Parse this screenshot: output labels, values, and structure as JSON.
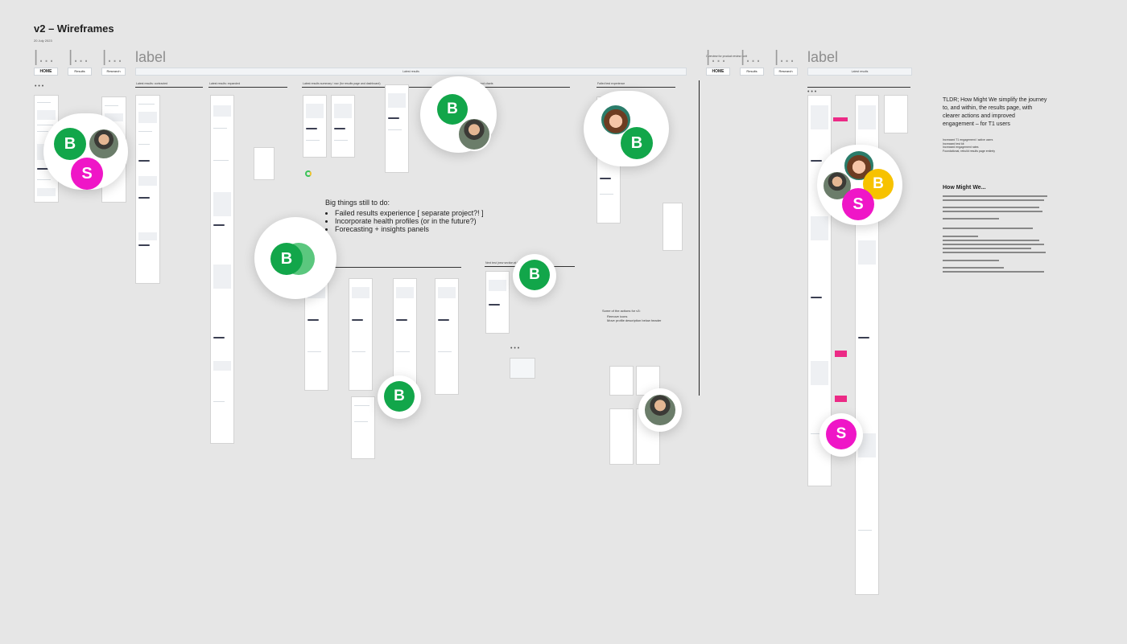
{
  "board": {
    "title": "v2 – Wireframes",
    "date": "20 July 2023"
  },
  "nav_left": {
    "placeholders": [
      "|...",
      "|...",
      "|..."
    ],
    "label": "label",
    "tabs": [
      "HOME",
      "Results",
      "Research"
    ]
  },
  "nav_right": {
    "placeholders": [
      "|...",
      "|...",
      "|..."
    ],
    "label": "label",
    "tabs": [
      "HOME",
      "Results",
      "Research"
    ],
    "overview_caption": "Overview for product review / crit"
  },
  "top_bar_caption": "Latest results",
  "section_labels": [
    "Latest results: contracted",
    "Latest results: expanded",
    "Latest results summary / nav (for results page and dashboard)",
    "Trend charts",
    "Failed test experience",
    "Next test (new section at bottom)"
  ],
  "big_things": {
    "heading": "Big things still to do:",
    "items": [
      "Failed results experience [ separate project?! ]",
      "Incorporate health profiles (or in the future?)",
      "Forecasting + insights panels"
    ]
  },
  "actions_note": {
    "heading": "Some of the actions for v3:",
    "items": [
      "Remove icons",
      "Move profile description below header"
    ]
  },
  "tldr": {
    "text": "TLDR; How Might We simplify the journey to, and within, the results page, with clearer actions and improved engagement – for T1 users",
    "goals": [
      "Increased T1 engagement / active users",
      "Increased test kit",
      "Increased engagement rates",
      "Foundational, rebuild results page entirely"
    ]
  },
  "hmw": {
    "heading": "How Might We..."
  },
  "avatars": {
    "b": "B",
    "s": "S"
  },
  "colors": {
    "green": "#12a64a",
    "magenta": "#ef16c7",
    "yellow": "#f7c200",
    "canvas": "#e6e6e6"
  }
}
